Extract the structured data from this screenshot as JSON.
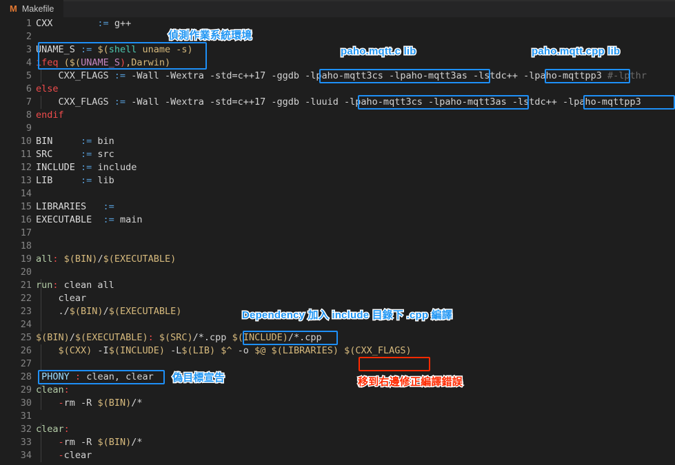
{
  "tab": {
    "label": "Makefile",
    "icon": "makefile-icon",
    "icon_glyph": "M"
  },
  "colors": {
    "editor_bg": "#1e1e1e",
    "tab_bg": "#252526",
    "annotation_blue": "#2196f3",
    "annotation_red": "#ff2a00",
    "box_blue": "#1e90f8",
    "box_red": "#ff2a00",
    "line_number": "#858585"
  },
  "editor": {
    "first_line": 1,
    "last_line": 34,
    "line_numbers": [
      1,
      2,
      3,
      4,
      5,
      6,
      7,
      8,
      9,
      10,
      11,
      12,
      13,
      14,
      15,
      16,
      17,
      18,
      19,
      20,
      21,
      22,
      23,
      24,
      25,
      26,
      27,
      28,
      29,
      30,
      31,
      32,
      33,
      34
    ],
    "lines": [
      {
        "n": 1,
        "text": "CXX        := g++"
      },
      {
        "n": 2,
        "text": ""
      },
      {
        "n": 3,
        "text": "UNAME_S := $(shell uname -s)"
      },
      {
        "n": 4,
        "text": "ifeq ($(UNAME_S),Darwin)"
      },
      {
        "n": 5,
        "text": "    CXX_FLAGS := -Wall -Wextra -std=c++17 -ggdb -lpaho-mqtt3cs -lpaho-mqtt3as -lstdc++ -lpaho-mqttpp3 #-lpthr"
      },
      {
        "n": 6,
        "text": "else"
      },
      {
        "n": 7,
        "text": "    CXX_FLAGS := -Wall -Wextra -std=c++17 -ggdb -luuid -lpaho-mqtt3cs -lpaho-mqtt3as -lstdc++ -lpaho-mqttpp3"
      },
      {
        "n": 8,
        "text": "endif"
      },
      {
        "n": 9,
        "text": ""
      },
      {
        "n": 10,
        "text": "BIN     := bin"
      },
      {
        "n": 11,
        "text": "SRC     := src"
      },
      {
        "n": 12,
        "text": "INCLUDE := include"
      },
      {
        "n": 13,
        "text": "LIB     := lib"
      },
      {
        "n": 14,
        "text": ""
      },
      {
        "n": 15,
        "text": "LIBRARIES   :="
      },
      {
        "n": 16,
        "text": "EXECUTABLE  := main"
      },
      {
        "n": 17,
        "text": ""
      },
      {
        "n": 18,
        "text": ""
      },
      {
        "n": 19,
        "text": "all: $(BIN)/$(EXECUTABLE)"
      },
      {
        "n": 20,
        "text": ""
      },
      {
        "n": 21,
        "text": "run: clean all"
      },
      {
        "n": 22,
        "text": "    clear"
      },
      {
        "n": 23,
        "text": "    ./$(BIN)/$(EXECUTABLE)"
      },
      {
        "n": 24,
        "text": ""
      },
      {
        "n": 25,
        "text": "$(BIN)/$(EXECUTABLE): $(SRC)/*.cpp $(INCLUDE)/*.cpp"
      },
      {
        "n": 26,
        "text": "    $(CXX) -I$(INCLUDE) -L$(LIB) $^ -o $@ $(LIBRARIES) $(CXX_FLAGS)"
      },
      {
        "n": 27,
        "text": ""
      },
      {
        "n": 28,
        "text": ".PHONY : clean, clear"
      },
      {
        "n": 29,
        "text": "clean:"
      },
      {
        "n": 30,
        "text": "    -rm -R $(BIN)/*"
      },
      {
        "n": 31,
        "text": ""
      },
      {
        "n": 32,
        "text": "clear:"
      },
      {
        "n": 33,
        "text": "    -rm -R $(BIN)/*"
      },
      {
        "n": 34,
        "text": "    -clear"
      }
    ]
  },
  "annotations": [
    {
      "id": "anno-os-detect",
      "text": "偵測作業系統環境",
      "color": "blue"
    },
    {
      "id": "anno-paho-c",
      "text": "paho.mqtt.c lib",
      "color": "blue"
    },
    {
      "id": "anno-paho-cpp",
      "text": "paho.mqtt.cpp lib",
      "color": "blue"
    },
    {
      "id": "anno-dependency",
      "text": "Dependency 加入 include 目錄下 .cpp 編譯",
      "color": "blue"
    },
    {
      "id": "anno-phony",
      "text": "偽目標宣告",
      "color": "blue"
    },
    {
      "id": "anno-move-right",
      "text": "移到右邊修正編譯錯誤",
      "color": "red"
    }
  ],
  "highlight_boxes": [
    {
      "id": "box-os-detect",
      "target": "lines 3-4 UNAME_S / ifeq",
      "color": "blue"
    },
    {
      "id": "box-paho-c-line5",
      "target": "-lpaho-mqtt3cs -lpaho-mqtt3as",
      "color": "blue"
    },
    {
      "id": "box-paho-cpp-line5",
      "target": "-lpaho-mqttpp3",
      "color": "blue"
    },
    {
      "id": "box-paho-c-line7",
      "target": "-lpaho-mqtt3cs -lpaho-mqtt3as",
      "color": "blue"
    },
    {
      "id": "box-paho-cpp-line7",
      "target": "-lpaho-mqttpp3",
      "color": "blue"
    },
    {
      "id": "box-include-dep",
      "target": "$(INCLUDE)/*.cpp",
      "color": "blue"
    },
    {
      "id": "box-cxx-flags",
      "target": "$(CXX_FLAGS)",
      "color": "red"
    },
    {
      "id": "box-phony",
      "target": ".PHONY : clean, clear",
      "color": "blue"
    }
  ]
}
